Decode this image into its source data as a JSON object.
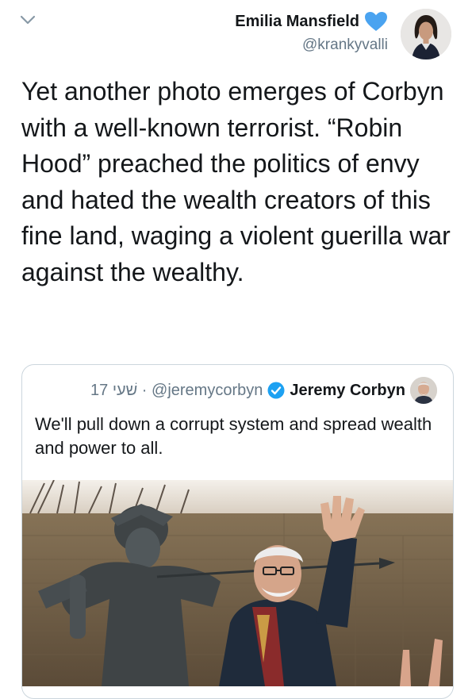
{
  "header": {
    "back_icon": "chevron-down-icon"
  },
  "author": {
    "name": "Emilia Mansfield",
    "handle": "@krankyvalli",
    "badge_icon": "blue-heart-icon",
    "badge_color": "#4aa3f0"
  },
  "tweet": {
    "text": "Yet another photo emerges of Corbyn with a well-known terrorist. “Robin Hood” preached the politics of envy and hated the wealth creators of this fine land, waging a violent guerilla war against the wealthy."
  },
  "quoted_tweet": {
    "meta": "17 שׁעי · @jeremycorbyn",
    "name": "Jeremy Corbyn",
    "verified_icon": "verified-badge-icon",
    "verified_color": "#1da1f2",
    "text": "We'll pull down a corrupt system and spread wealth and power to all."
  }
}
